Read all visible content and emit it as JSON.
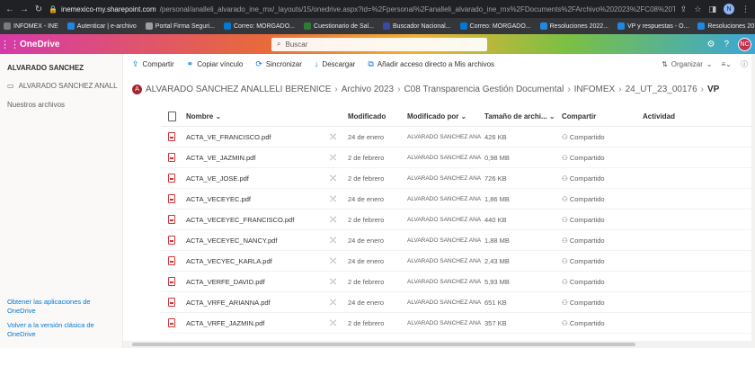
{
  "browser": {
    "url_host": "inemexico-my.sharepoint.com",
    "url_path": "/personal/analleli_alvarado_ine_mx/_layouts/15/onedrive.aspx?id=%2Fpersonal%2Fanalleli_alvarado_ine_mx%2FDocuments%2FArchivo%202023%2FC08%20Transpar...",
    "profile_initial": "N"
  },
  "bookmarks": [
    {
      "label": "INFOMEX - INE",
      "color": "#7b7b7b"
    },
    {
      "label": "Autenticar | e-archivo",
      "color": "#1e88e5"
    },
    {
      "label": "Portal Firma Seguri...",
      "color": "#9e9e9e"
    },
    {
      "label": "Correo: MORGADO...",
      "color": "#0078d4"
    },
    {
      "label": "Cuestionario de Sal...",
      "color": "#2e7d32"
    },
    {
      "label": "Buscador Nacional...",
      "color": "#3949ab"
    },
    {
      "label": "Correo: MORGADO...",
      "color": "#0078d4"
    },
    {
      "label": "Resoluciones 2022...",
      "color": "#1e88e5"
    },
    {
      "label": "VP y respuestas - O...",
      "color": "#1e88e5"
    },
    {
      "label": "Resoluciones 2019...",
      "color": "#1e88e5"
    }
  ],
  "suite": {
    "app_name": "OneDrive",
    "search_placeholder": "Buscar",
    "help": "?",
    "user_initials": "NC"
  },
  "leftnav": {
    "user_name": "ALVARADO SANCHEZ",
    "my_files": "ALVARADO SANCHEZ ANALL",
    "shared": "Nuestros archivos",
    "get_apps": "Obtener las aplicaciones de OneDrive",
    "classic": "Volver a la versión clásica de OneDrive"
  },
  "commands": {
    "share": "Compartir",
    "copy_link": "Copiar vínculo",
    "sync": "Sincronizar",
    "download": "Descargar",
    "shortcut": "Añadir acceso directo a Mis archivos",
    "organize": "Organizar"
  },
  "breadcrumb": {
    "owner_initial": "A",
    "items": [
      "ALVARADO SANCHEZ ANALLELI BERENICE",
      "Archivo 2023",
      "C08 Transparencia Gestión Documental",
      "INFOMEX",
      "24_UT_23_00176"
    ],
    "current": "VP"
  },
  "columns": {
    "name": "Nombre",
    "modified": "Modificado",
    "modified_by": "Modificado por",
    "size": "Tamaño de archi...",
    "sharing": "Compartir",
    "activity": "Actividad"
  },
  "files": [
    {
      "name": "ACTA_VE_FRANCISCO.pdf",
      "modified": "24 de enero",
      "by": "ALVARADO SANCHEZ ANA",
      "size": "426 KB",
      "sharing": "Compartido"
    },
    {
      "name": "ACTA_VE_JAZMIN.pdf",
      "modified": "2 de febrero",
      "by": "ALVARADO SANCHEZ ANA",
      "size": "0,98 MB",
      "sharing": "Compartido"
    },
    {
      "name": "ACTA_VE_JOSE.pdf",
      "modified": "2 de febrero",
      "by": "ALVARADO SANCHEZ ANA",
      "size": "726 KB",
      "sharing": "Compartido"
    },
    {
      "name": "ACTA_VECEYEC.pdf",
      "modified": "24 de enero",
      "by": "ALVARADO SANCHEZ ANA",
      "size": "1,86 MB",
      "sharing": "Compartido"
    },
    {
      "name": "ACTA_VECEYEC_FRANCISCO.pdf",
      "modified": "2 de febrero",
      "by": "ALVARADO SANCHEZ ANA",
      "size": "440 KB",
      "sharing": "Compartido"
    },
    {
      "name": "ACTA_VECEYEC_NANCY.pdf",
      "modified": "24 de enero",
      "by": "ALVARADO SANCHEZ ANA",
      "size": "1,88 MB",
      "sharing": "Compartido"
    },
    {
      "name": "ACTA_VECYEC_KARLA.pdf",
      "modified": "24 de enero",
      "by": "ALVARADO SANCHEZ ANA",
      "size": "2,43 MB",
      "sharing": "Compartido"
    },
    {
      "name": "ACTA_VERFE_DAVID.pdf",
      "modified": "2 de febrero",
      "by": "ALVARADO SANCHEZ ANA",
      "size": "5,93 MB",
      "sharing": "Compartido"
    },
    {
      "name": "ACTA_VRFE_ARIANNA.pdf",
      "modified": "24 de enero",
      "by": "ALVARADO SANCHEZ ANA",
      "size": "651 KB",
      "sharing": "Compartido"
    },
    {
      "name": "ACTA_VRFE_JAZMIN.pdf",
      "modified": "2 de febrero",
      "by": "ALVARADO SANCHEZ ANA",
      "size": "357 KB",
      "sharing": "Compartido"
    }
  ]
}
